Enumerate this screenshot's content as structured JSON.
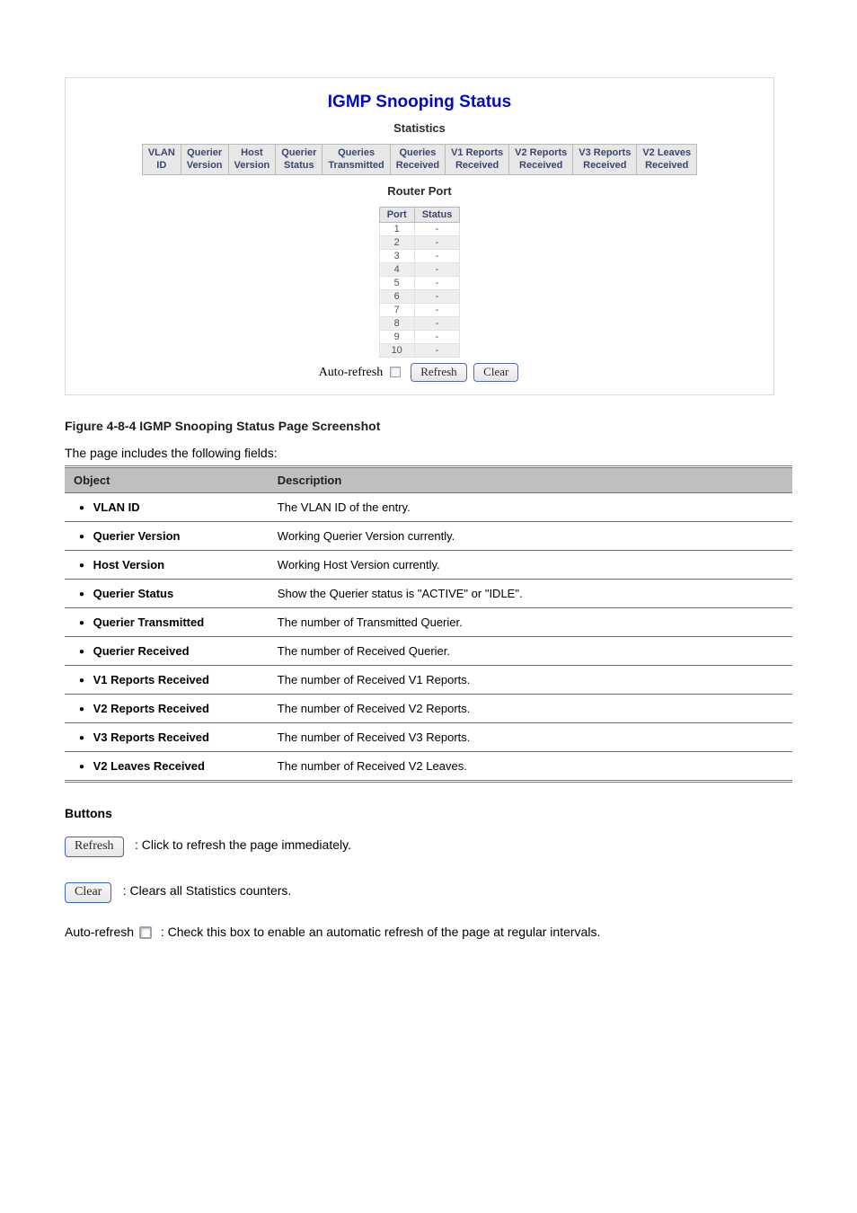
{
  "panel": {
    "title": "IGMP Snooping Status",
    "statistics_heading": "Statistics",
    "stats_headers": [
      "VLAN\nID",
      "Querier\nVersion",
      "Host\nVersion",
      "Querier\nStatus",
      "Queries\nTransmitted",
      "Queries\nReceived",
      "V1 Reports\nReceived",
      "V2 Reports\nReceived",
      "V3 Reports\nReceived",
      "V2 Leaves\nReceived"
    ],
    "router_port_heading": "Router Port",
    "router_headers": [
      "Port",
      "Status"
    ],
    "router_rows": [
      {
        "port": "1",
        "status": "-"
      },
      {
        "port": "2",
        "status": "-"
      },
      {
        "port": "3",
        "status": "-"
      },
      {
        "port": "4",
        "status": "-"
      },
      {
        "port": "5",
        "status": "-"
      },
      {
        "port": "6",
        "status": "-"
      },
      {
        "port": "7",
        "status": "-"
      },
      {
        "port": "8",
        "status": "-"
      },
      {
        "port": "9",
        "status": "-"
      },
      {
        "port": "10",
        "status": "-"
      }
    ],
    "auto_refresh_label": "Auto-refresh",
    "refresh_label": "Refresh",
    "clear_label": "Clear"
  },
  "figure_caption": "Figure 4-8-4 IGMP Snooping Status Page Screenshot",
  "intro": "The page includes the following fields:",
  "table": {
    "head_object": "Object",
    "head_desc": "Description",
    "rows": [
      {
        "obj": "VLAN ID",
        "desc": "The VLAN ID of the entry."
      },
      {
        "obj": "Querier Version",
        "desc": "Working Querier Version currently."
      },
      {
        "obj": "Host Version",
        "desc": "Working Host Version currently."
      },
      {
        "obj": "Querier Status",
        "desc": "Show the Querier status is \"ACTIVE\" or \"IDLE\"."
      },
      {
        "obj": "Querier Transmitted",
        "desc": "The number of Transmitted Querier."
      },
      {
        "obj": "Querier Received",
        "desc": "The number of Received Querier."
      },
      {
        "obj": "V1 Reports Received",
        "desc": "The number of Received V1 Reports."
      },
      {
        "obj": "V2 Reports Received",
        "desc": "The number of Received V2 Reports."
      },
      {
        "obj": "V3 Reports Received",
        "desc": "The number of Received V3 Reports."
      },
      {
        "obj": "V2 Leaves Received",
        "desc": "The number of Received V2 Leaves."
      }
    ]
  },
  "buttons_heading": "Buttons",
  "refresh_btn": "Refresh",
  "refresh_desc": ": Click to refresh the page immediately.",
  "clear_btn": "Clear",
  "clear_desc_1": ": Clears all Statistics counters.",
  "auto_refresh_label2": "Auto-refresh",
  "auto_refresh_tail": ": Check this box to enable an automatic refresh of the page at regular intervals."
}
